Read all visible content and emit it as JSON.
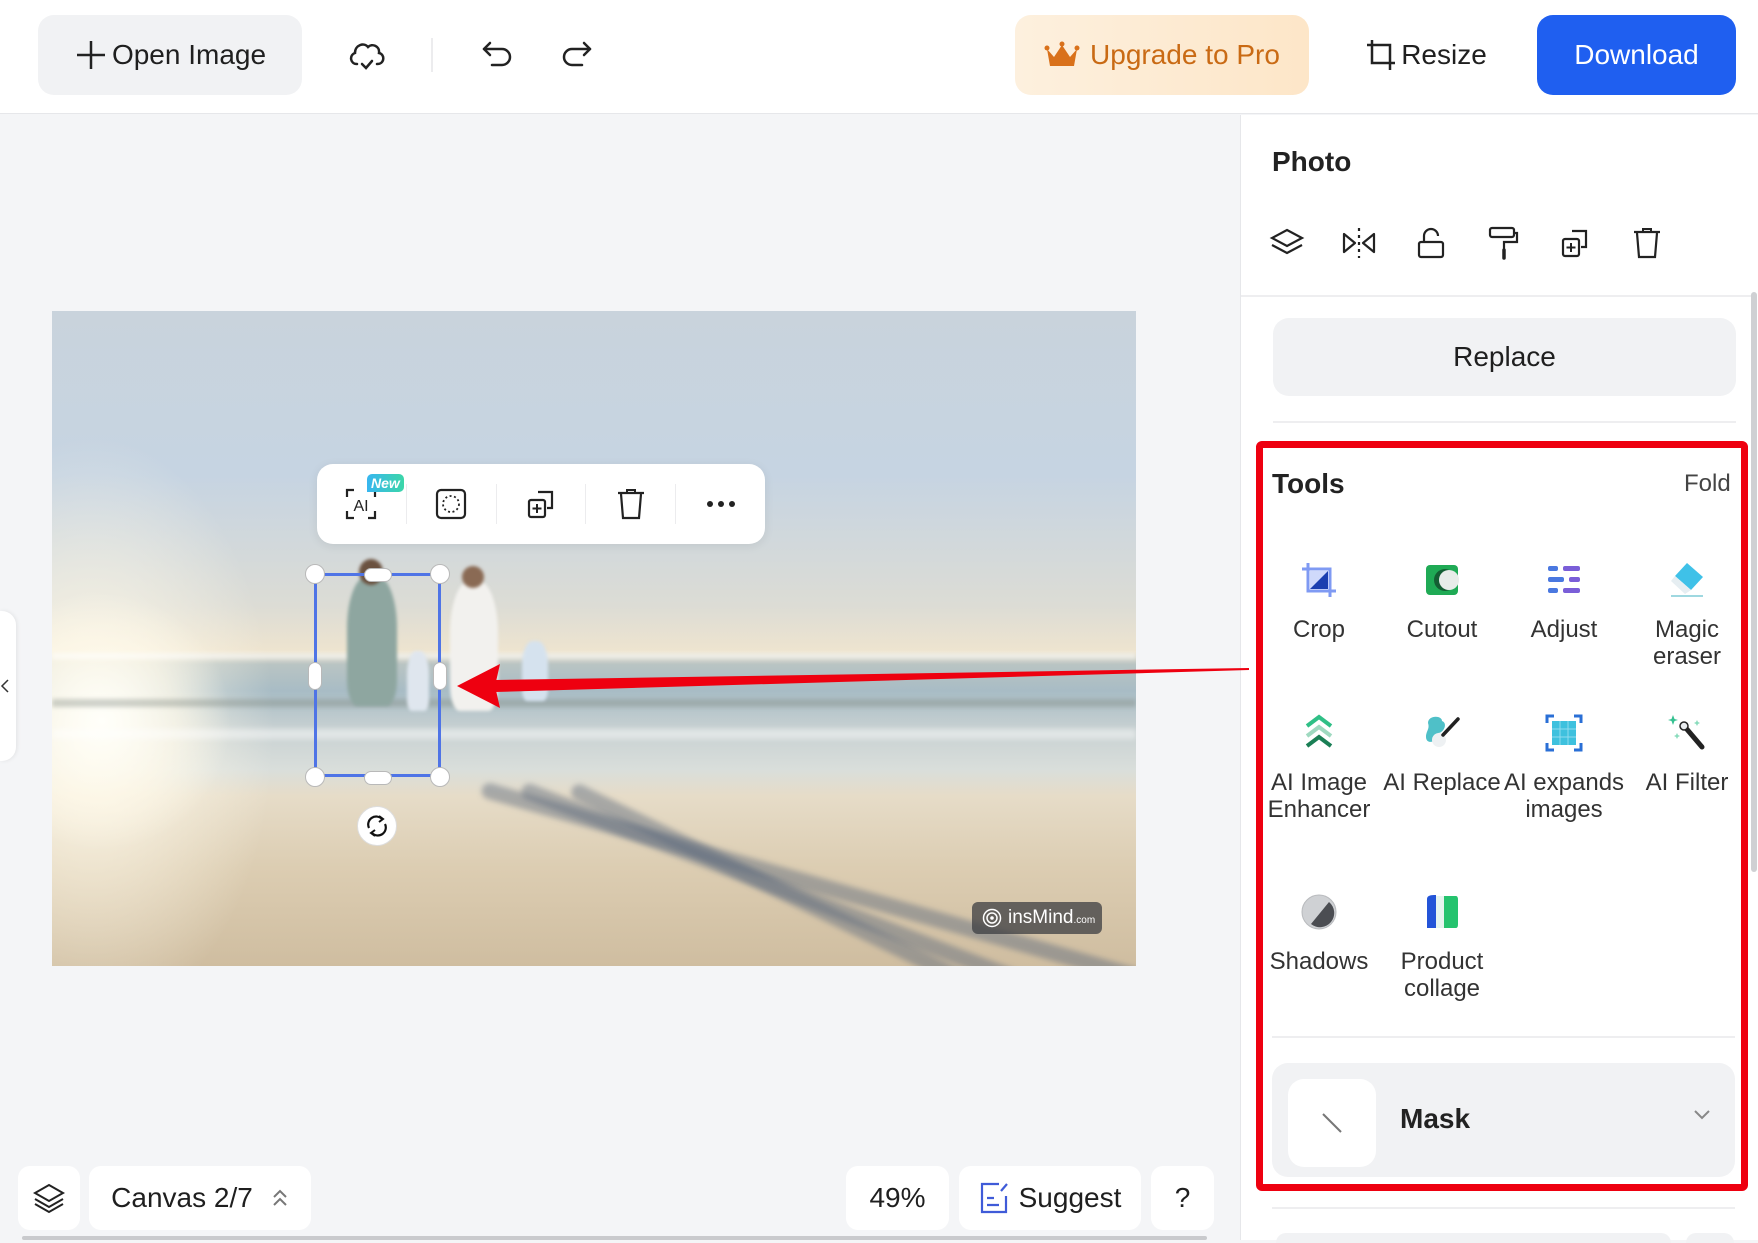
{
  "header": {
    "open_image_label": "Open Image",
    "upgrade_label": "Upgrade to Pro",
    "resize_label": "Resize",
    "download_label": "Download",
    "icons": [
      "plus-icon",
      "cloud-saved-icon",
      "undo-icon",
      "redo-icon",
      "crown-icon",
      "crop-resize-icon"
    ]
  },
  "canvas": {
    "floating_toolbar": {
      "new_badge": "New",
      "ai_label": "AI",
      "items": [
        "ai-select-icon",
        "mask-select-icon",
        "duplicate-icon",
        "delete-icon",
        "more-icon"
      ]
    },
    "watermark": {
      "brand": "insMind",
      "suffix": ".com"
    }
  },
  "bottom_bar": {
    "canvas_label": "Canvas 2/7",
    "zoom_level": "49%",
    "suggest_label": "Suggest",
    "help_label": "?"
  },
  "sidebar": {
    "title": "Photo",
    "icons": [
      "layers-icon",
      "flip-icon",
      "unlock-icon",
      "paint-roller-icon",
      "duplicate-icon",
      "trash-icon"
    ],
    "replace_label": "Replace",
    "tools": {
      "title": "Tools",
      "fold_label": "Fold",
      "items": [
        {
          "label": "Crop",
          "icon": "crop-icon"
        },
        {
          "label": "Cutout",
          "icon": "cutout-icon"
        },
        {
          "label": "Adjust",
          "icon": "adjust-icon"
        },
        {
          "label": "Magic eraser",
          "icon": "eraser-icon"
        },
        {
          "label": "AI Image Enhancer",
          "icon": "enhancer-icon"
        },
        {
          "label": "AI Replace",
          "icon": "ai-replace-icon"
        },
        {
          "label": "AI expands images",
          "icon": "expand-icon"
        },
        {
          "label": "AI Filter",
          "icon": "magic-wand-icon"
        },
        {
          "label": "Shadows",
          "icon": "shadows-icon"
        },
        {
          "label": "Product collage",
          "icon": "collage-icon"
        }
      ]
    },
    "mask": {
      "label": "Mask"
    }
  },
  "colors": {
    "accent_blue": "#1f5ff0",
    "upgrade_text": "#c96a14",
    "highlight_red": "#ee0010",
    "selection_blue": "#4f74e6"
  }
}
